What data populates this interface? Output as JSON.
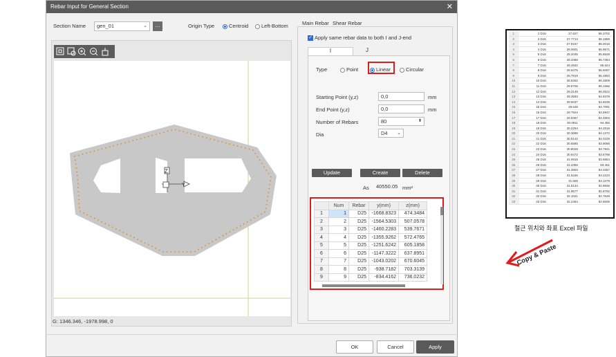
{
  "window": {
    "title": "Rebar Input for General Section"
  },
  "section": {
    "name_label": "Section Name",
    "name_value": "gen_01",
    "more_label": "..."
  },
  "origin": {
    "label": "Origin Type",
    "options": [
      "Centroid",
      "Left-Bottom"
    ],
    "selected": "Centroid"
  },
  "tabs": [
    "Main Rebar",
    "Shear Rebar"
  ],
  "active_tab": "Main Rebar",
  "apply_same_label": "Apply same rebar data to both I and J-end",
  "end_tabs": [
    "I",
    "J"
  ],
  "type": {
    "label": "Type",
    "options": [
      "Point",
      "Linear",
      "Circular"
    ],
    "selected": "Linear"
  },
  "fields": {
    "start_label": "Starting Point (y,z)",
    "start_value": "0,0",
    "start_unit": "mm",
    "end_label": "End Point (y,z)",
    "end_value": "0,0",
    "end_unit": "mm",
    "count_label": "Number of Rebars",
    "count_value": "80",
    "dia_label": "Dia",
    "dia_value": "D4"
  },
  "actions": {
    "update": "Update",
    "create": "Create",
    "delete": "Delete"
  },
  "as": {
    "label": "As",
    "value": "40550.05",
    "unit": "mm²"
  },
  "table": {
    "headers": [
      "",
      "Num",
      "Rebar",
      "y(mm)",
      "z(mm)"
    ],
    "rows": [
      [
        "1",
        "1",
        "D25",
        "-1668.8323",
        "474.3484"
      ],
      [
        "2",
        "2",
        "D25",
        "-1564.5303",
        "507.0578"
      ],
      [
        "3",
        "3",
        "D25",
        "-1460.2283",
        "539.7671"
      ],
      [
        "4",
        "4",
        "D25",
        "-1355.9262",
        "572.4765"
      ],
      [
        "5",
        "5",
        "D25",
        "-1251.6242",
        "605.1858"
      ],
      [
        "6",
        "6",
        "D25",
        "-1147.3222",
        "637.8951"
      ],
      [
        "7",
        "7",
        "D25",
        "-1043.0202",
        "670.6045"
      ],
      [
        "8",
        "8",
        "D25",
        "-938.7182",
        "703.3139"
      ],
      [
        "9",
        "9",
        "D25",
        "-834.4162",
        "736.0232"
      ]
    ]
  },
  "status": {
    "coords": "G: 1346.346, -1978.998, 0"
  },
  "footer": {
    "ok": "OK",
    "cancel": "Cancel",
    "apply": "Apply"
  },
  "axis": {
    "z": "Z",
    "y": "Y"
  },
  "toolbar_icons": [
    "zoom-fit-icon",
    "zoom-window-icon",
    "zoom-in-icon",
    "zoom-out-icon",
    "pan-icon"
  ],
  "excel": {
    "caption": "철근 위치와 좌표 Excel 파일",
    "rows": [
      [
        "1",
        "1 D16",
        "27.627",
        "86.3702"
      ],
      [
        "2",
        "2 D16",
        "27.7714",
        "86.1859"
      ],
      [
        "3",
        "3 D16",
        "27.9157",
        "86.0015"
      ],
      [
        "4",
        "4 D16",
        "28.0601",
        "85.9671"
      ],
      [
        "5",
        "5 D16",
        "28.2045",
        "85.8528"
      ],
      [
        "6",
        "6 D16",
        "28.3488",
        "85.7384"
      ],
      [
        "7",
        "7 D16",
        "28.4932",
        "85.624"
      ],
      [
        "8",
        "8 D16",
        "28.6375",
        "85.5097"
      ],
      [
        "9",
        "9 D16",
        "28.7819",
        "85.3953"
      ],
      [
        "10",
        "10 D16",
        "28.9262",
        "85.2809"
      ],
      [
        "11",
        "11 D16",
        "29.0706",
        "85.1666"
      ],
      [
        "12",
        "12 D16",
        "29.2149",
        "85.0522"
      ],
      [
        "13",
        "13 D16",
        "29.3593",
        "84.9378"
      ],
      [
        "14",
        "14 D16",
        "29.5037",
        "84.8235"
      ],
      [
        "15",
        "15 D16",
        "29.648",
        "84.7091"
      ],
      [
        "16",
        "16 D16",
        "29.7924",
        "84.5947"
      ],
      [
        "17",
        "17 D16",
        "29.9367",
        "84.4803"
      ],
      [
        "18",
        "18 D16",
        "30.0811",
        "84.366"
      ],
      [
        "19",
        "19 D16",
        "30.2254",
        "84.2516"
      ],
      [
        "20",
        "20 D16",
        "30.3698",
        "84.1372"
      ],
      [
        "21",
        "21 D16",
        "30.5142",
        "84.0229"
      ],
      [
        "22",
        "22 D16",
        "30.6585",
        "83.9085"
      ],
      [
        "23",
        "23 D16",
        "30.8029",
        "83.7941"
      ],
      [
        "24",
        "24 D16",
        "30.9472",
        "83.6798"
      ],
      [
        "25",
        "25 D16",
        "31.0916",
        "83.5654"
      ],
      [
        "26",
        "26 D16",
        "31.2359",
        "83.451"
      ],
      [
        "27",
        "27 D16",
        "31.3803",
        "83.3367"
      ],
      [
        "28",
        "28 D16",
        "31.5246",
        "83.2223"
      ],
      [
        "29",
        "29 D16",
        "31.669",
        "83.1079"
      ],
      [
        "30",
        "30 D16",
        "31.8134",
        "82.9936"
      ],
      [
        "31",
        "31 D16",
        "31.9577",
        "82.8792"
      ],
      [
        "32",
        "32 D16",
        "32.1021",
        "82.7648"
      ],
      [
        "33",
        "33 D16",
        "32.2464",
        "82.6505"
      ]
    ]
  },
  "annotation": {
    "copy_paste": "Copy & Paste"
  },
  "colors": {
    "highlight": "#e01b1b",
    "section_fill": "#c8c8c8",
    "rebar": "#e58a1f",
    "selection": "#cfe3fb"
  }
}
